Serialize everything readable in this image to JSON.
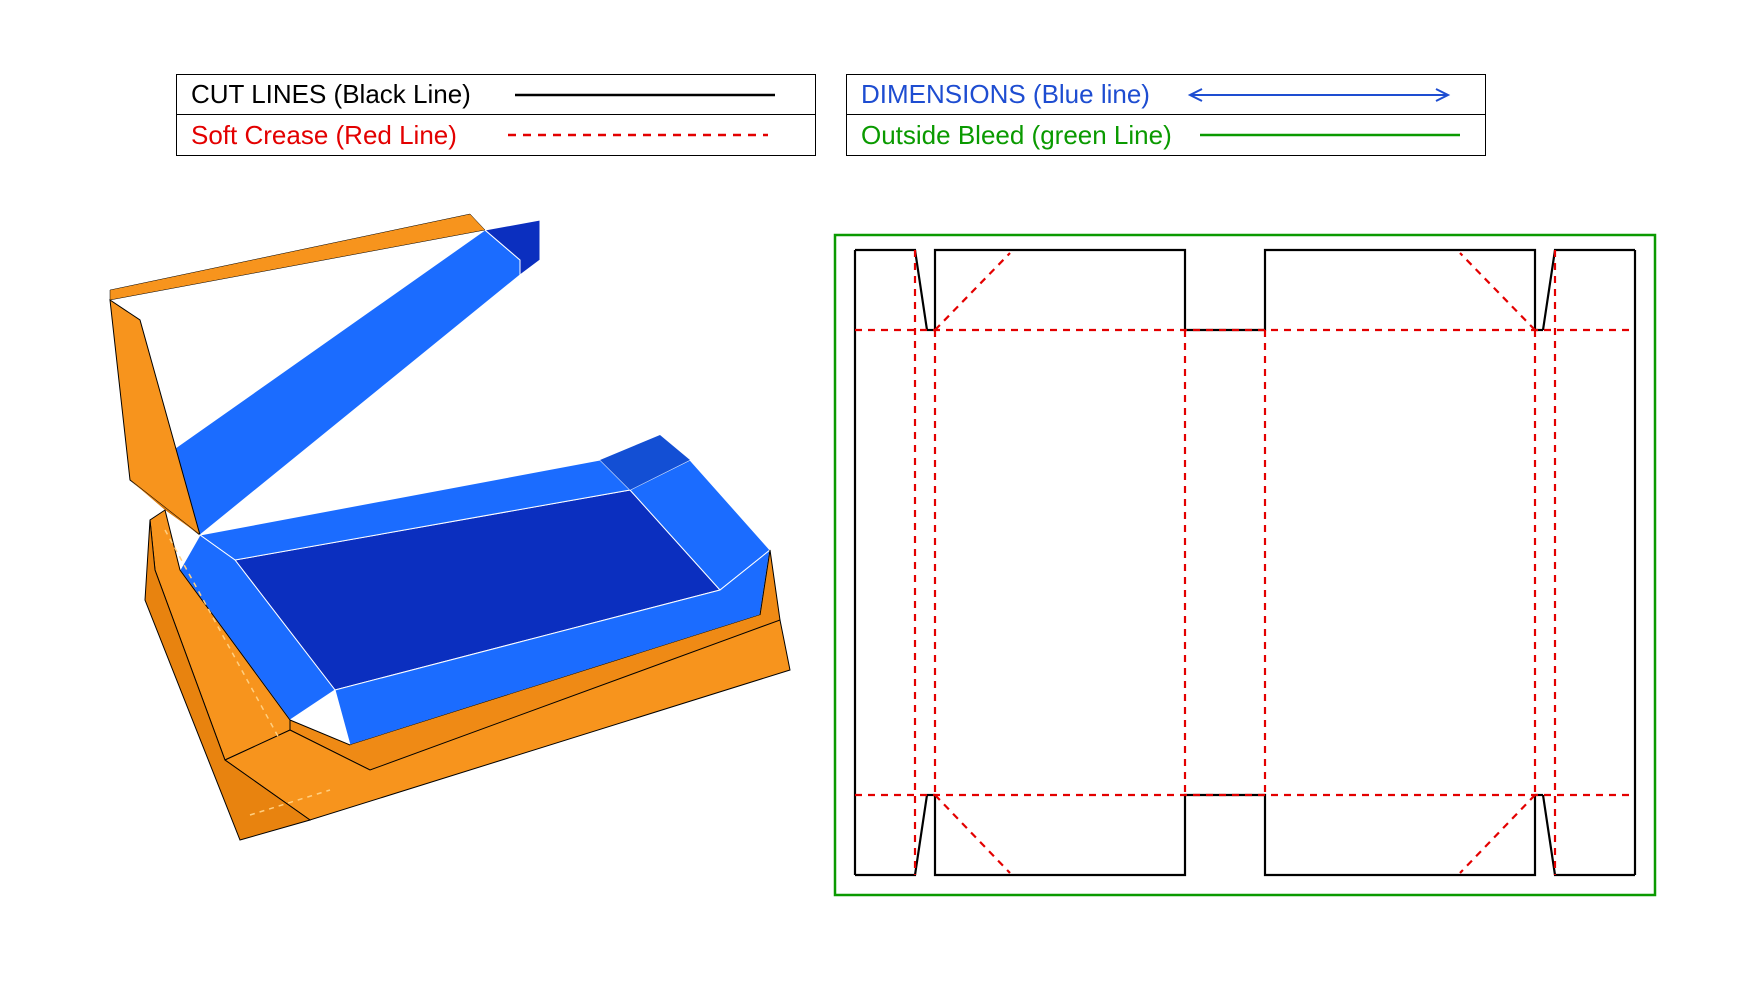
{
  "legend": {
    "left": {
      "row1": {
        "label": "CUT LINES (Black Line)",
        "color": "#000000",
        "style": "solid"
      },
      "row2": {
        "label": "Soft Crease (Red Line)",
        "color": "#e30000",
        "style": "dashed"
      }
    },
    "right": {
      "row1": {
        "label": "DIMENSIONS (Blue line)",
        "color": "#1e4dd1",
        "style": "arrow"
      },
      "row2": {
        "label": "Outside Bleed (green Line)",
        "color": "#0a9a00",
        "style": "solid"
      }
    }
  },
  "diagram": {
    "description": "Packaging dieline template with 3D mockup",
    "mockup": {
      "type": "open-hinged-box",
      "exterior_color": "#f7941d",
      "interior_color": "#1b6cff",
      "interior_floor_color": "#0b2fbf"
    },
    "dieline": {
      "bleed_color": "#0a9a00",
      "cut_color": "#000000",
      "crease_color": "#e30000",
      "panels": "two main panels with hinge, side flaps with diagonal crease corners, top and bottom dust flaps"
    }
  }
}
